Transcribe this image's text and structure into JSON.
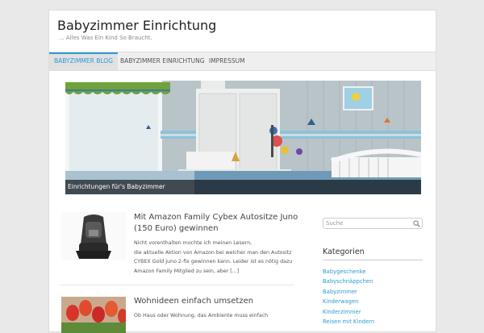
{
  "header": {
    "site_title": "Babyzimmer Einrichtung",
    "tagline": "... Alles Was Ein Kind So Braucht."
  },
  "nav": {
    "items": [
      {
        "label": "BABYZIMMER BLOG",
        "active": true
      },
      {
        "label": "BABYZIMMER EINRICHTUNG",
        "active": false
      },
      {
        "label": "IMPRESSUM",
        "active": false
      }
    ]
  },
  "hero": {
    "caption": "Einrichtungen für's Babyzimmer"
  },
  "posts": [
    {
      "title": "Mit Amazon Family Cybex Autositze Juno (150 Euro) gewinnen",
      "excerpt_lines": [
        "Nicht vorenthalten mochte ich meinen Lesern,",
        "die aktuelle Aktion von Amazon bei welcher man den Autositz",
        "CYBEX Gold Juno 2-fix gewinnen kann. Leider ist es nötig dazu",
        "Amazon Family Mitglied zu sein, aber [...]"
      ]
    },
    {
      "title": "Wohnideen einfach umsetzen",
      "excerpt_lines": [
        "Ob Haus oder Wohnung, das Ambiente muss einfach"
      ]
    }
  ],
  "sidebar": {
    "search_placeholder": "Suche",
    "categories_title": "Kategorien",
    "categories": [
      "Babygeschenke",
      "Babyschnäppchen",
      "Babyzimmer",
      "Kinderwagen",
      "Kinderzimmer",
      "Reisen mit Kindern"
    ]
  },
  "colors": {
    "accent": "#2b9bd6",
    "nav_bg": "#efefef",
    "page_bg": "#e9e9e9"
  },
  "icons": {
    "search": "search-icon"
  }
}
